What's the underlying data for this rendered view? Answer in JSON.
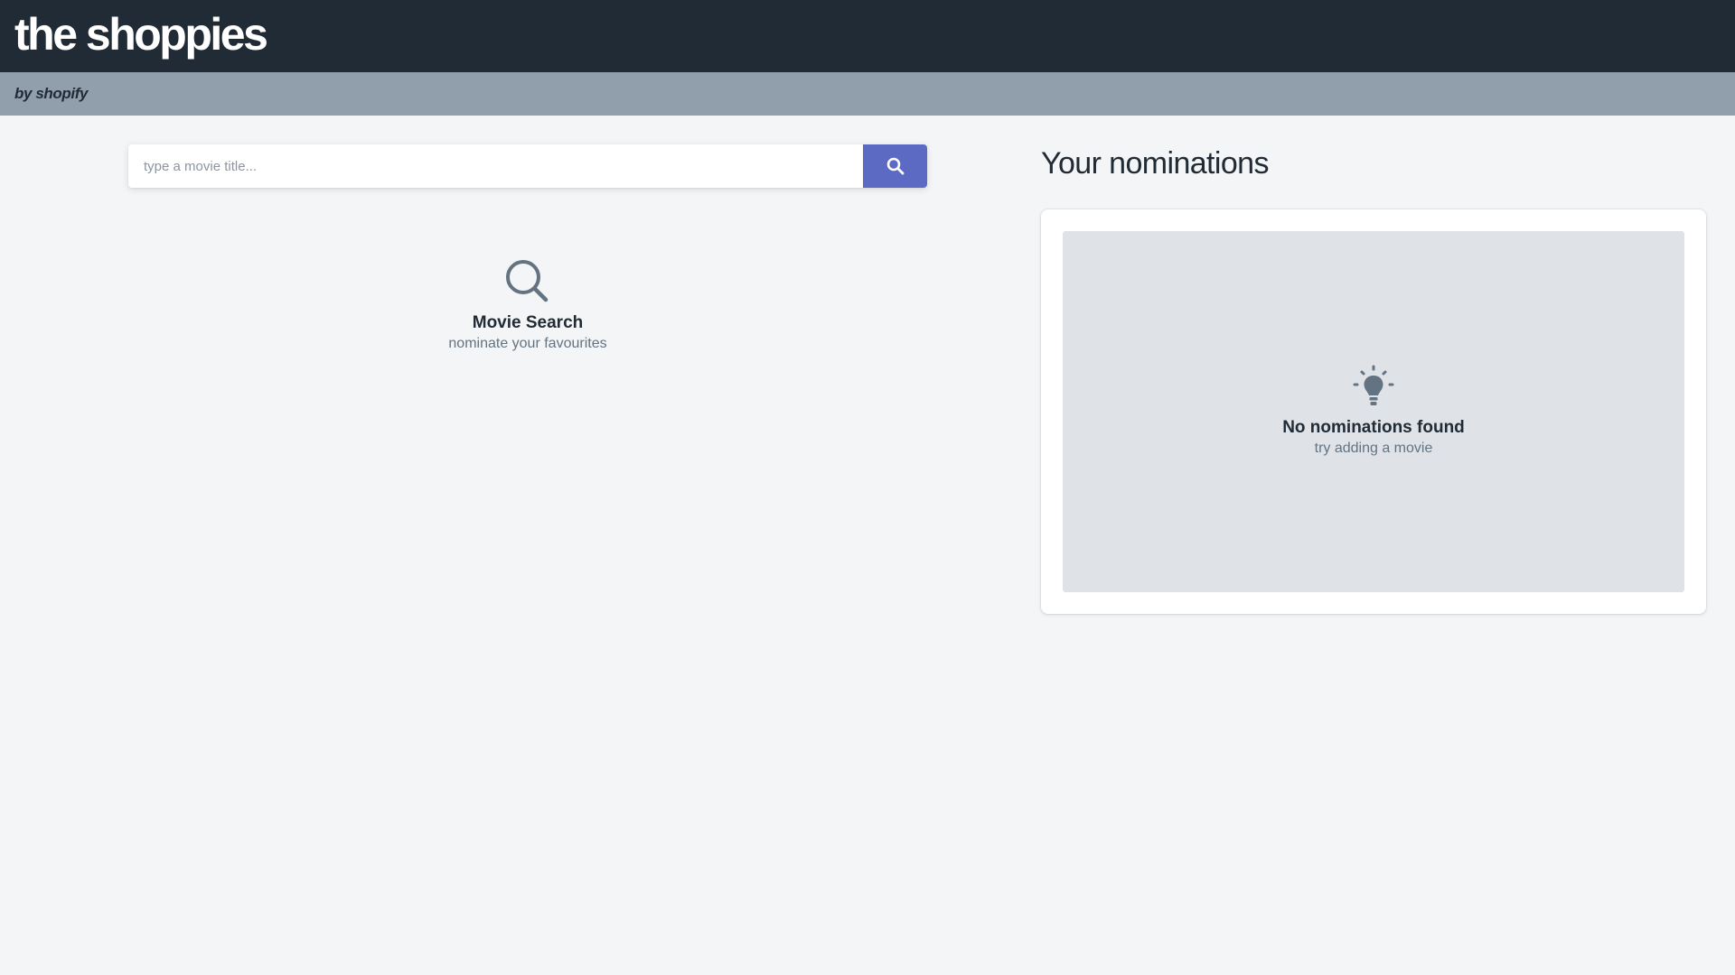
{
  "header": {
    "title": "the shoppies",
    "byline": "by shopify"
  },
  "search": {
    "placeholder": "type a movie title...",
    "value": "",
    "button_icon": "search-icon"
  },
  "search_empty_state": {
    "icon": "magnifier-icon",
    "title": "Movie Search",
    "subtitle": "nominate your favourites"
  },
  "nominations": {
    "heading": "Your nominations",
    "empty_state": {
      "icon": "lightbulb-icon",
      "title": "No nominations found",
      "subtitle": "try adding a movie"
    }
  },
  "colors": {
    "topbar": "#212b36",
    "subbar": "#919eab",
    "accent": "#5c6ac4",
    "page_background": "#f4f5f7",
    "empty_panel": "#dfe3e8"
  }
}
